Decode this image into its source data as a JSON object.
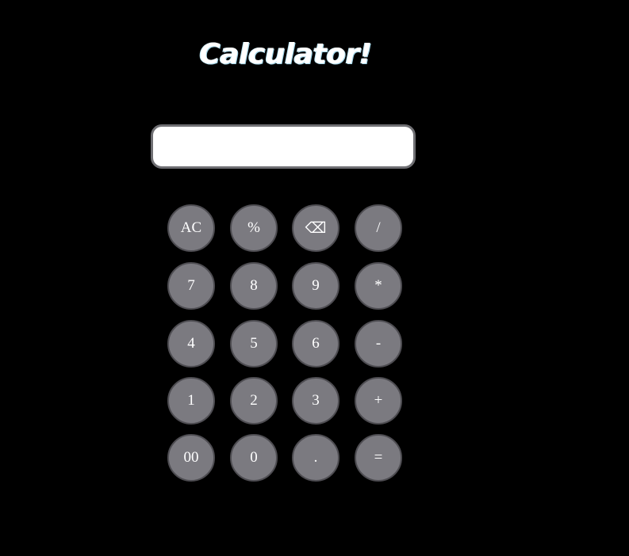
{
  "header": {
    "title": "Calculator!"
  },
  "display": {
    "value": "",
    "placeholder": ""
  },
  "keypad": {
    "rows": [
      [
        {
          "name": "clear-button",
          "label": "AC"
        },
        {
          "name": "percent-button",
          "label": "%"
        },
        {
          "name": "backspace-button",
          "label": "⌫"
        },
        {
          "name": "divide-button",
          "label": "/"
        }
      ],
      [
        {
          "name": "digit-7-button",
          "label": "7"
        },
        {
          "name": "digit-8-button",
          "label": "8"
        },
        {
          "name": "digit-9-button",
          "label": "9"
        },
        {
          "name": "multiply-button",
          "label": "*"
        }
      ],
      [
        {
          "name": "digit-4-button",
          "label": "4"
        },
        {
          "name": "digit-5-button",
          "label": "5"
        },
        {
          "name": "digit-6-button",
          "label": "6"
        },
        {
          "name": "subtract-button",
          "label": "-"
        }
      ],
      [
        {
          "name": "digit-1-button",
          "label": "1"
        },
        {
          "name": "digit-2-button",
          "label": "2"
        },
        {
          "name": "digit-3-button",
          "label": "3"
        },
        {
          "name": "add-button",
          "label": "+"
        }
      ],
      [
        {
          "name": "double-zero-button",
          "label": "00"
        },
        {
          "name": "digit-0-button",
          "label": "0"
        },
        {
          "name": "decimal-button",
          "label": "."
        },
        {
          "name": "equals-button",
          "label": "="
        }
      ]
    ]
  },
  "colors": {
    "background": "#000000",
    "key_fill": "#7b7a80",
    "key_border": "#4e4d52",
    "display_fill": "#ffffff",
    "display_border": "#6f6f73"
  }
}
